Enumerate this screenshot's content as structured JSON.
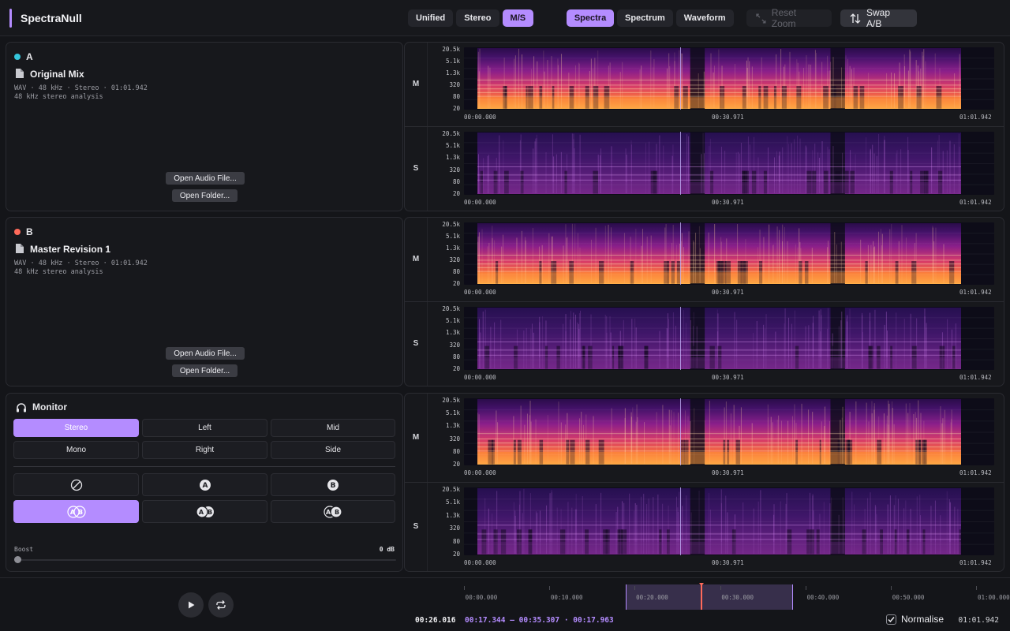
{
  "app": {
    "title": "SpectraNull"
  },
  "header": {
    "channel_modes": [
      "Unified",
      "Stereo",
      "M/S"
    ],
    "channel_active": "M/S",
    "view_modes": [
      "Spectra",
      "Spectrum",
      "Waveform"
    ],
    "view_active": "Spectra",
    "reset_zoom": "Reset Zoom",
    "swap": "Swap A/B"
  },
  "tracks": [
    {
      "letter": "A",
      "color": "#35c6dc",
      "name": "Original Mix",
      "meta": "WAV · 48 kHz · Stereo · 01:01.942",
      "meta2": "48 kHz stereo analysis",
      "open_file": "Open Audio File...",
      "open_folder": "Open Folder..."
    },
    {
      "letter": "B",
      "color": "#ff6a5a",
      "name": "Master Revision 1",
      "meta": "WAV · 48 kHz · Stereo · 01:01.942",
      "meta2": "48 kHz stereo analysis",
      "open_file": "Open Audio File...",
      "open_folder": "Open Folder..."
    }
  ],
  "monitor": {
    "title": "Monitor",
    "modes": [
      "Stereo",
      "Left",
      "Mid",
      "Mono",
      "Right",
      "Side"
    ],
    "mode_active": "Stereo",
    "sources": [
      {
        "icon": "mute-icon",
        "label": ""
      },
      {
        "icon": "a-icon",
        "label": "A"
      },
      {
        "icon": "b-icon",
        "label": "B"
      },
      {
        "icon": "ab-overlap-icon",
        "label": "A B"
      },
      {
        "icon": "a-over-b-icon",
        "label": "A B"
      },
      {
        "icon": "b-over-a-icon",
        "label": "A B"
      }
    ],
    "source_active_index": 3,
    "boost_label": "Boost",
    "boost_value": "0 dB",
    "boost_level": 0
  },
  "spectrograms": {
    "freq_ticks": [
      "20.5k",
      "5.1k",
      "1.3k",
      "320",
      "80",
      "20"
    ],
    "time_ticks": [
      "00:00.000",
      "00:30.971",
      "01:01.942"
    ],
    "lanes": [
      "M",
      "S"
    ]
  },
  "timeline": {
    "ticks": [
      "00:00.000",
      "00:10.000",
      "00:20.000",
      "00:30.000",
      "00:40.000",
      "00:50.000",
      "01:00.000"
    ],
    "selection_start_s": 17.344,
    "selection_end_s": 35.307,
    "playhead_s": 26.016,
    "duration_s": 61.942,
    "current_time": "00:26.016",
    "selection_text": "00:17.344 — 00:35.307 · 00:17.963",
    "normalise_label": "Normalise",
    "normalise_checked": true,
    "total_time": "01:01.942"
  }
}
